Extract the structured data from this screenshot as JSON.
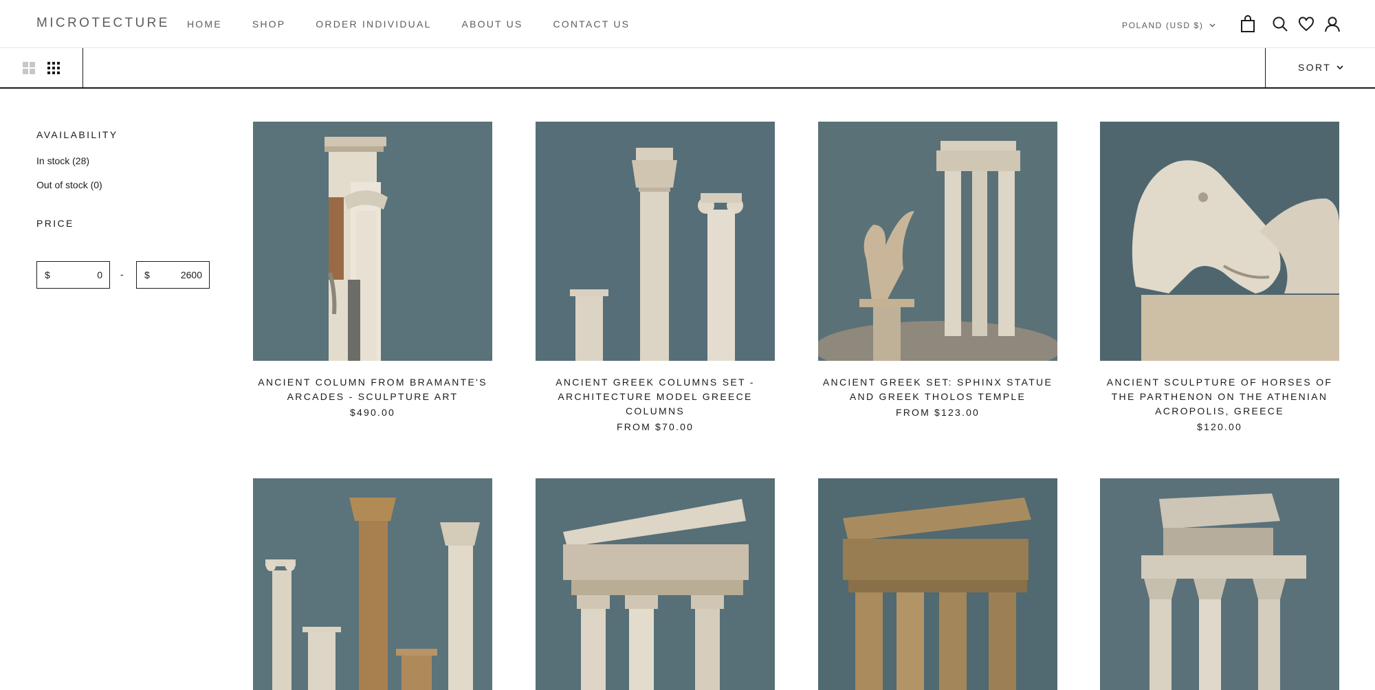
{
  "header": {
    "logo": "MICROTECTURE",
    "nav": [
      "HOME",
      "SHOP",
      "ORDER INDIVIDUAL",
      "ABOUT US",
      "CONTACT US"
    ],
    "locale": "POLAND (USD $)",
    "icons": [
      "cart-icon",
      "search-icon",
      "heart-icon",
      "user-icon"
    ]
  },
  "toolbar": {
    "sort_label": "SORT",
    "view_modes": [
      "grid-2-icon",
      "grid-4-icon"
    ],
    "active_view": "grid-4-icon"
  },
  "filters": {
    "availability_title": "AVAILABILITY",
    "in_stock": "In stock (28)",
    "out_of_stock": "Out of stock (0)",
    "price_title": "PRICE",
    "currency_symbol": "$",
    "min_value": "0",
    "max_value": "2600",
    "range_separator": "-"
  },
  "products": [
    {
      "name": "ANCIENT COLUMN FROM BRAMANTE'S ARCADES - SCULPTURE ART",
      "price": "$490.00"
    },
    {
      "name": "ANCIENT GREEK COLUMNS SET - ARCHITECTURE MODEL GREECE COLUMNS",
      "price": "FROM $70.00"
    },
    {
      "name": "ANCIENT GREEK SET: SPHINX STATUE AND GREEK THOLOS TEMPLE",
      "price": "FROM $123.00"
    },
    {
      "name": "ANCIENT SCULPTURE OF HORSES OF THE PARTHENON ON THE ATHENIAN ACROPOLIS, GREECE",
      "price": "$120.00"
    },
    {
      "name": "",
      "price": ""
    },
    {
      "name": "",
      "price": ""
    },
    {
      "name": "",
      "price": ""
    },
    {
      "name": "",
      "price": ""
    }
  ],
  "colors": {
    "photo_background": "#587078",
    "stone": "#d9d1c2",
    "text": "#1c1b1b",
    "muted": "#5c5c5c"
  }
}
